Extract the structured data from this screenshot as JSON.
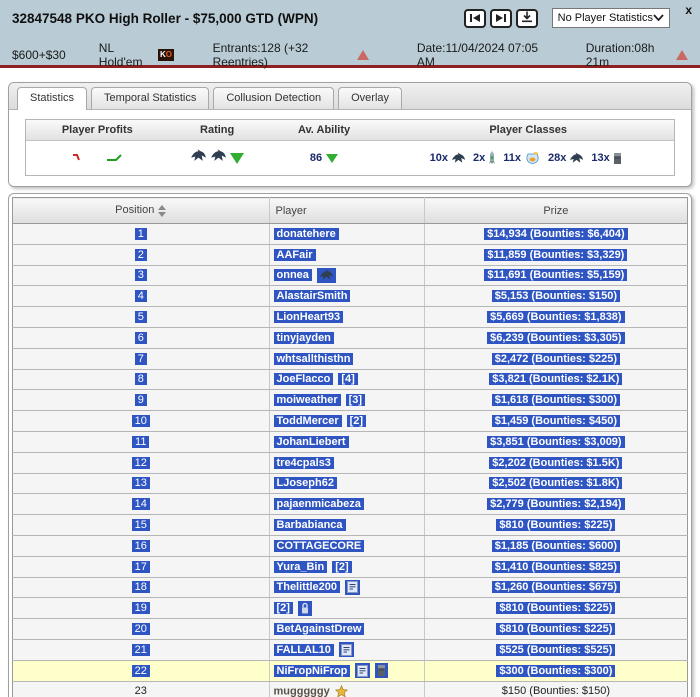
{
  "window": {
    "title": "32847548 PKO High Roller - $75,000 GTD (WPN)",
    "close_label": "x"
  },
  "toolbar": {
    "dropdown_value": "No Player Statistics"
  },
  "info": {
    "buyin": "$600+$30",
    "game": "NL Hold'em",
    "ko_badge": "KO",
    "entrants": "Entrants:128 (+32 Reentries)",
    "date": "Date:11/04/2024 07:05 AM",
    "duration": "Duration:08h 21m"
  },
  "tabs": [
    {
      "label": "Statistics",
      "active": true
    },
    {
      "label": "Temporal Statistics",
      "active": false
    },
    {
      "label": "Collusion Detection",
      "active": false
    },
    {
      "label": "Overlay",
      "active": false
    }
  ],
  "stats": {
    "columns": [
      "Player Profits",
      "Rating",
      "Av. Ability",
      "Player Classes"
    ],
    "av_ability": "86",
    "player_classes": [
      {
        "count": "10x",
        "icon": "shark"
      },
      {
        "count": "2x",
        "icon": "rocket"
      },
      {
        "count": "11x",
        "icon": "fishbowl"
      },
      {
        "count": "28x",
        "icon": "shark"
      },
      {
        "count": "13x",
        "icon": "brick"
      }
    ]
  },
  "table": {
    "columns": [
      "Position",
      "Player",
      "Prize"
    ],
    "rows": [
      {
        "position": "1",
        "player": "donatehere",
        "tag": "",
        "icons": [],
        "prize": "$14,934  (Bounties: $6,404)",
        "selected": true,
        "highlight": false
      },
      {
        "position": "2",
        "player": "AAFair",
        "tag": "",
        "icons": [],
        "prize": "$11,859  (Bounties: $3,329)",
        "selected": true,
        "highlight": false
      },
      {
        "position": "3",
        "player": "onnea",
        "tag": "",
        "icons": [
          "shark"
        ],
        "prize": "$11,691  (Bounties: $5,159)",
        "selected": true,
        "highlight": false
      },
      {
        "position": "4",
        "player": "AlastairSmith",
        "tag": "",
        "icons": [],
        "prize": "$5,153  (Bounties: $150)",
        "selected": true,
        "highlight": false
      },
      {
        "position": "5",
        "player": "LionHeart93",
        "tag": "",
        "icons": [],
        "prize": "$5,669  (Bounties: $1,838)",
        "selected": true,
        "highlight": false
      },
      {
        "position": "6",
        "player": "tinyjayden",
        "tag": "",
        "icons": [],
        "prize": "$6,239  (Bounties: $3,305)",
        "selected": true,
        "highlight": false
      },
      {
        "position": "7",
        "player": "whtsallthisthn",
        "tag": "",
        "icons": [],
        "prize": "$2,472  (Bounties: $225)",
        "selected": true,
        "highlight": false
      },
      {
        "position": "8",
        "player": "JoeFlacco",
        "tag": "[4]",
        "icons": [],
        "prize": "$3,821  (Bounties: $2.1K)",
        "selected": true,
        "highlight": false
      },
      {
        "position": "9",
        "player": "moiweather",
        "tag": "[3]",
        "icons": [],
        "prize": "$1,618  (Bounties: $300)",
        "selected": true,
        "highlight": false
      },
      {
        "position": "10",
        "player": "ToddMercer",
        "tag": "[2]",
        "icons": [],
        "prize": "$1,459  (Bounties: $450)",
        "selected": true,
        "highlight": false
      },
      {
        "position": "11",
        "player": "JohanLiebert",
        "tag": "",
        "icons": [],
        "prize": "$3,851  (Bounties: $3,009)",
        "selected": true,
        "highlight": false
      },
      {
        "position": "12",
        "player": "tre4cpals3",
        "tag": "",
        "icons": [],
        "prize": "$2,202  (Bounties: $1.5K)",
        "selected": true,
        "highlight": false
      },
      {
        "position": "13",
        "player": "LJoseph62",
        "tag": "",
        "icons": [],
        "prize": "$2,502  (Bounties: $1.8K)",
        "selected": true,
        "highlight": false
      },
      {
        "position": "14",
        "player": "pajaenmicabeza",
        "tag": "",
        "icons": [],
        "prize": "$2,779  (Bounties: $2,194)",
        "selected": true,
        "highlight": false
      },
      {
        "position": "15",
        "player": "Barbabianca",
        "tag": "",
        "icons": [],
        "prize": "$810  (Bounties: $225)",
        "selected": true,
        "highlight": false
      },
      {
        "position": "16",
        "player": "COTTAGECORE",
        "tag": "",
        "icons": [],
        "prize": "$1,185  (Bounties: $600)",
        "selected": true,
        "highlight": false
      },
      {
        "position": "17",
        "player": "Yura_Bin",
        "tag": "[2]",
        "icons": [],
        "prize": "$1,410  (Bounties: $825)",
        "selected": true,
        "highlight": false
      },
      {
        "position": "18",
        "player": "Thelittle200",
        "tag": "",
        "icons": [
          "note"
        ],
        "prize": "$1,260  (Bounties: $675)",
        "selected": true,
        "highlight": false
      },
      {
        "position": "19",
        "player": "[2]",
        "tag": "",
        "icons": [
          "lock"
        ],
        "prize": "$810  (Bounties: $225)",
        "selected": true,
        "highlight": false
      },
      {
        "position": "20",
        "player": "BetAgainstDrew",
        "tag": "",
        "icons": [],
        "prize": "$810  (Bounties: $225)",
        "selected": true,
        "highlight": false
      },
      {
        "position": "21",
        "player": "FALLAL10",
        "tag": "",
        "icons": [
          "note"
        ],
        "prize": "$525  (Bounties: $525)",
        "selected": true,
        "highlight": false
      },
      {
        "position": "22",
        "player": "NiFropNiFrop",
        "tag": "",
        "icons": [
          "note",
          "brick"
        ],
        "prize": "$300  (Bounties: $300)",
        "selected": true,
        "highlight": true
      },
      {
        "position": "23",
        "player": "mugggggy",
        "tag": "",
        "icons": [
          "star"
        ],
        "prize": "$150  (Bounties: $150)",
        "selected": false,
        "highlight": false
      }
    ]
  }
}
